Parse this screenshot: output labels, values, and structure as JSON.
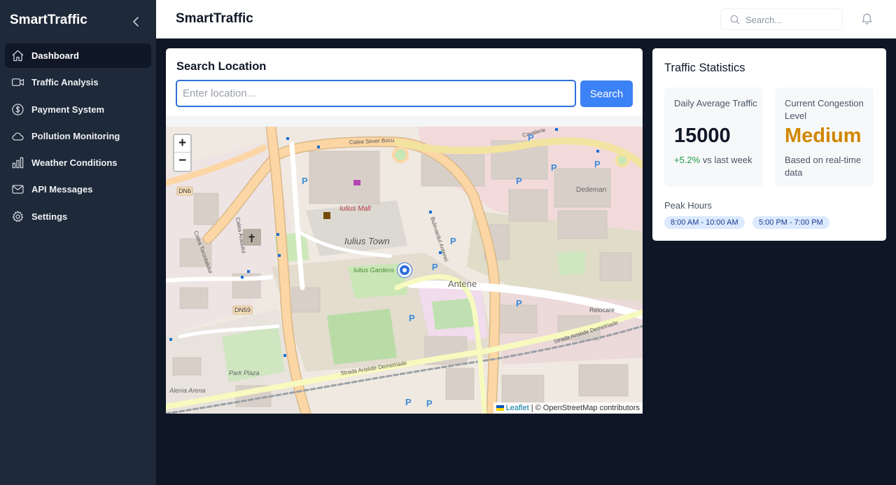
{
  "app": {
    "brand": "SmartTraffic"
  },
  "sidebar": {
    "items": [
      {
        "label": "Dashboard",
        "icon": "home-icon",
        "active": true
      },
      {
        "label": "Traffic Analysis",
        "icon": "video-camera-icon"
      },
      {
        "label": "Payment System",
        "icon": "dollar-circle-icon"
      },
      {
        "label": "Pollution Monitoring",
        "icon": "cloud-icon"
      },
      {
        "label": "Weather Conditions",
        "icon": "bar-chart-icon"
      },
      {
        "label": "API Messages",
        "icon": "mail-icon"
      },
      {
        "label": "Settings",
        "icon": "gear-icon"
      }
    ]
  },
  "header": {
    "title": "SmartTraffic",
    "search_placeholder": "Search..."
  },
  "search_location": {
    "title": "Search Location",
    "input_placeholder": "Enter location...",
    "input_value": "",
    "button_label": "Search"
  },
  "map": {
    "zoom_in": "+",
    "zoom_out": "−",
    "attribution_link": "Leaflet",
    "attribution_text": "| © OpenStreetMap contributors",
    "labels": {
      "mall": "Iulius Mall",
      "town": "Iulius Town",
      "gardens": "Iulius Gardens",
      "antene": "Antene",
      "dedeman": "Dedeman",
      "dn6": "DN6",
      "dn59": "DN59",
      "park_plaza": "Park Plaza",
      "alenia": "Alenia Arena",
      "sever_bocu": "Calea Sever Bocu",
      "aradului": "Calea Aradului",
      "bulevardul_antenei": "Bulevardul Antenei",
      "strada_aristide_1": "Strada Aristide Demetriade",
      "strada_aristide_2": "Strada Aristide Demetriade",
      "relocare": "Relocare",
      "cavalerie": "Cavalerie",
      "torontalului": "Calea Torontalului"
    }
  },
  "stats": {
    "title": "Traffic Statistics",
    "daily": {
      "label": "Daily Average Traffic",
      "value": "15000",
      "change": "+5.2%",
      "change_suffix": " vs last week"
    },
    "congestion": {
      "label": "Current Congestion Level",
      "value": "Medium",
      "note": "Based on real-time data",
      "color": "#d08700"
    },
    "peak_label": "Peak Hours",
    "peak_hours": [
      "8:00 AM - 10:00 AM",
      "5:00 PM - 7:00 PM"
    ]
  },
  "colors": {
    "sidebar_bg": "#1e2939",
    "accent": "#3b82f6",
    "positive": "#1e9a44"
  }
}
